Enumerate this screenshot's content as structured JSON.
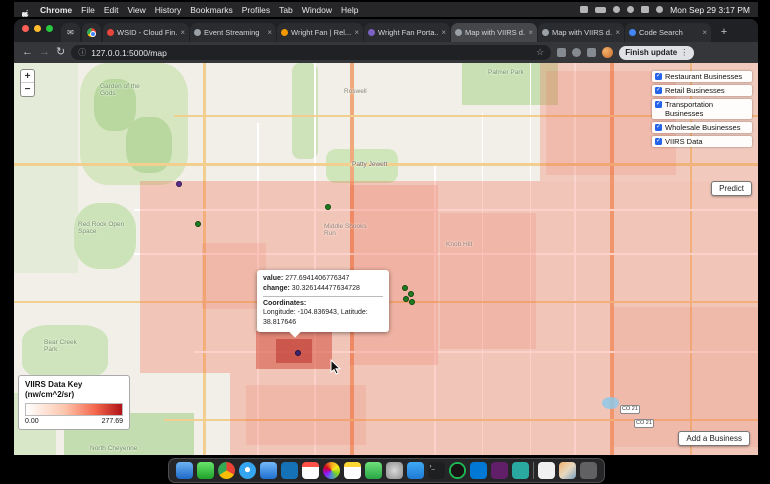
{
  "colors": {
    "heatmap_max": "#b11218",
    "checkbox_accent": "#2563eb",
    "marker_green": "#1e7d1e",
    "marker_purple": "#5b2d8e"
  },
  "menubar": {
    "items": [
      "Chrome",
      "File",
      "Edit",
      "View",
      "History",
      "Bookmarks",
      "Profiles",
      "Tab",
      "Window",
      "Help"
    ],
    "clock": "Mon Sep 29 3:17 PM"
  },
  "browser": {
    "tabs": [
      {
        "title": "WSID - Cloud Fin..."
      },
      {
        "title": "Event Streaming"
      },
      {
        "title": "Wright Fan | Rel..."
      },
      {
        "title": "Wright Fan Porta..."
      },
      {
        "title": "Map with VIIRS d..."
      },
      {
        "title": "Map with VIIRS d..."
      },
      {
        "title": "Code Search"
      }
    ],
    "url": "127.0.0.1:5000/map",
    "update_button": "Finish update"
  },
  "map": {
    "zoom_in": "+",
    "zoom_out": "−",
    "layers": [
      {
        "label": "Restaurant Businesses"
      },
      {
        "label": "Retail Businesses"
      },
      {
        "label": "Transportation Businesses"
      },
      {
        "label": "Wholesale Businesses"
      },
      {
        "label": "VIIRS Data"
      }
    ],
    "predict_button": "Predict",
    "add_business_button": "Add a Business",
    "popup": {
      "value_label": "value:",
      "value": "277.6941406776347",
      "change_label": "change:",
      "change": "30.326144477634728",
      "coordinates_label": "Coordinates:",
      "coordinates": "Longitude: -104.836943, Latitude: 38.817646"
    },
    "legend": {
      "title": "VIIRS Data Key",
      "units": "(nw/cm^2/sr)",
      "min": "0.00",
      "max": "277.69"
    },
    "place_labels": [
      {
        "text": "Garden of the Gods"
      },
      {
        "text": "Roswell"
      },
      {
        "text": "Patty Jewett"
      },
      {
        "text": "Palmer Park"
      },
      {
        "text": "Red Rock Open Space"
      },
      {
        "text": "Bear Creek Park"
      },
      {
        "text": "North Cheyenne"
      },
      {
        "text": "Middle Shooks Run"
      },
      {
        "text": "Knob Hill"
      },
      {
        "text": "CO 21"
      },
      {
        "text": "CO 21"
      }
    ]
  }
}
